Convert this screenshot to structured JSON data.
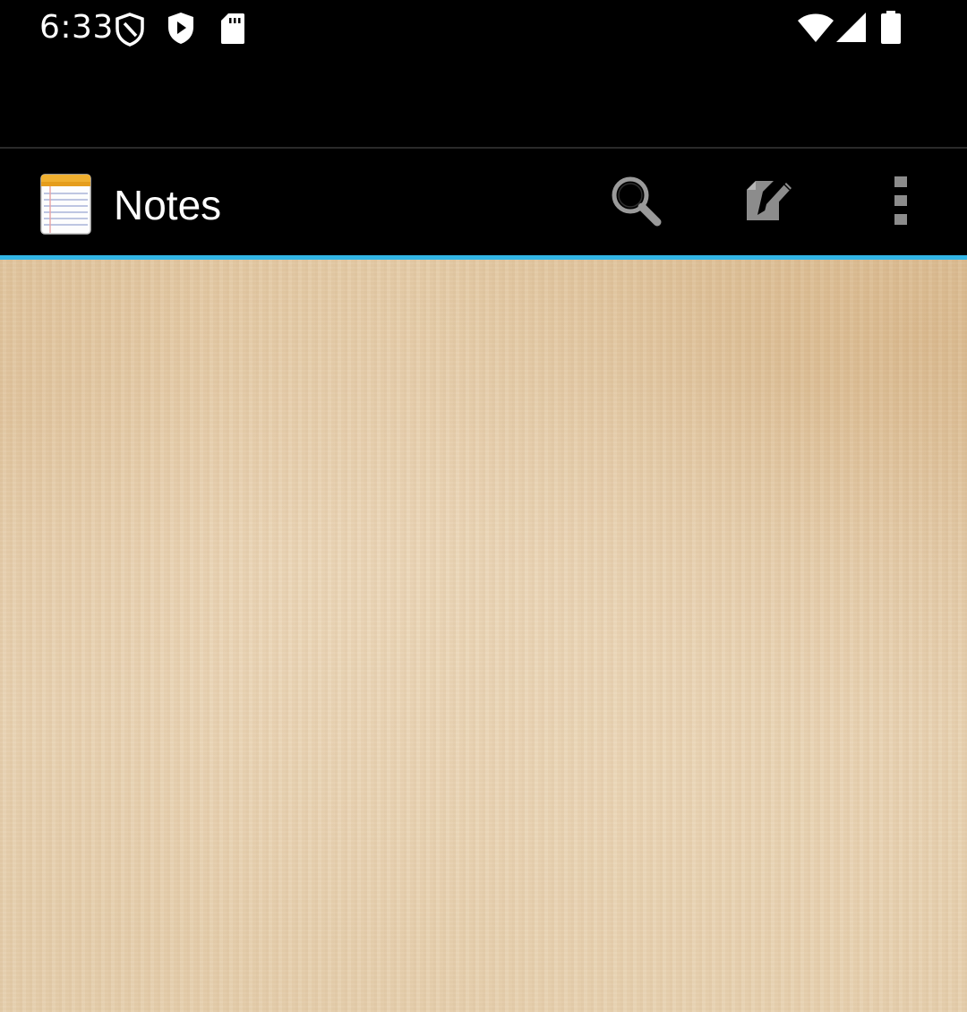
{
  "status_bar": {
    "time": "6:33",
    "icons_left": [
      "shield-icon",
      "play-shield-icon",
      "sd-card-icon"
    ],
    "icons_right": [
      "wifi-icon",
      "cell-signal-icon",
      "battery-icon"
    ]
  },
  "action_bar": {
    "title": "Notes",
    "app_icon": "notepad-icon",
    "actions": [
      "search-icon",
      "new-note-icon",
      "overflow-menu-icon"
    ],
    "accent_color": "#33b5e5"
  },
  "content": {
    "background": "parchment",
    "base_color": "#e4cdab"
  }
}
